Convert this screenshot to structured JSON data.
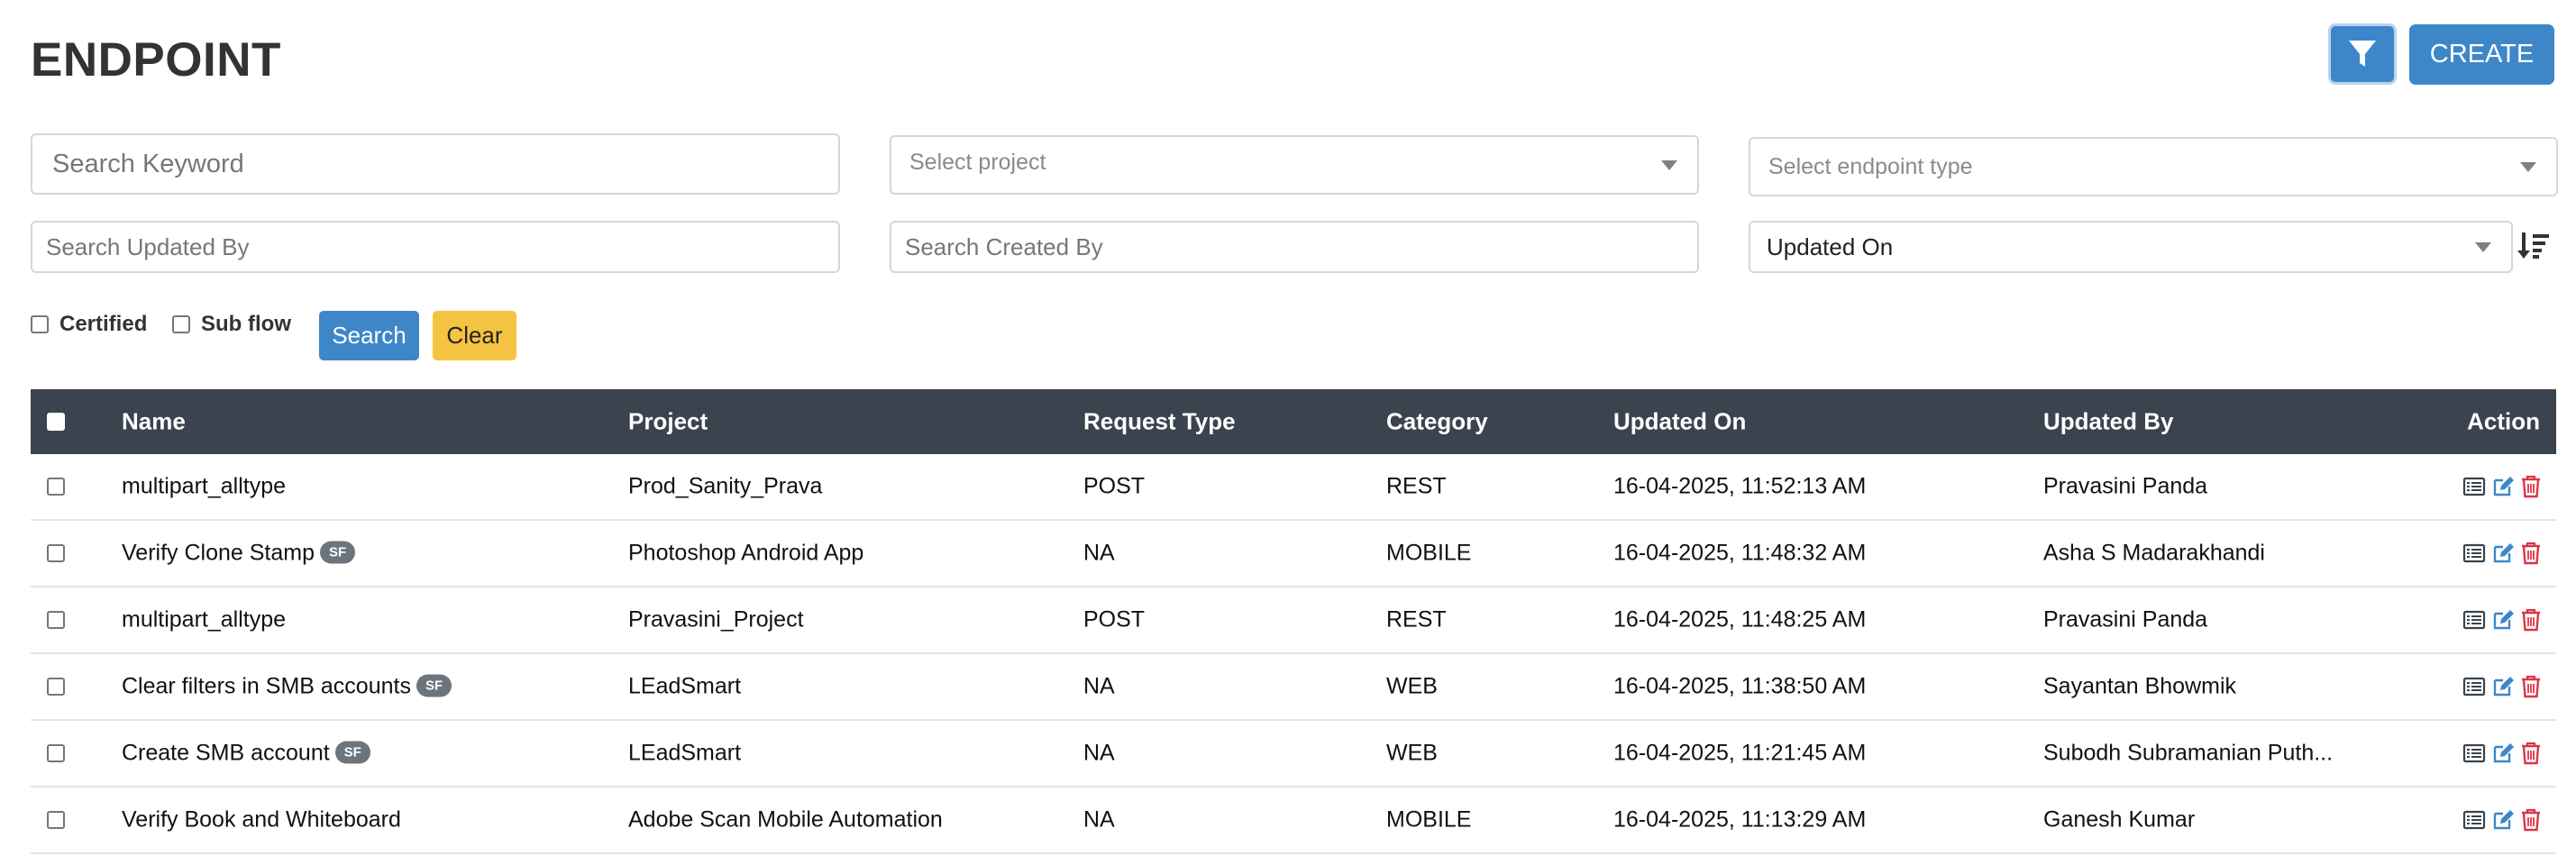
{
  "page": {
    "title": "ENDPOINT"
  },
  "toolbar": {
    "filter_icon": "filter-icon",
    "create_label": "CREATE"
  },
  "filters": {
    "search_keyword_placeholder": "Search Keyword",
    "project_placeholder": "Select project",
    "endpoint_type_placeholder": "Select endpoint type",
    "updated_by_placeholder": "Search Updated By",
    "created_by_placeholder": "Search Created By",
    "sort_by_value": "Updated On",
    "certified_label": "Certified",
    "subflow_label": "Sub flow",
    "search_label": "Search",
    "clear_label": "Clear"
  },
  "table": {
    "columns": [
      "Name",
      "Project",
      "Request Type",
      "Category",
      "Updated On",
      "Updated By",
      "Action"
    ],
    "rows": [
      {
        "name": "multipart_alltype",
        "badge": "",
        "project": "Prod_Sanity_Prava",
        "request_type": "POST",
        "category": "REST",
        "updated_on": "16-04-2025, 11:52:13 AM",
        "updated_by": "Pravasini Panda"
      },
      {
        "name": "Verify Clone Stamp",
        "badge": "SF",
        "project": "Photoshop Android App",
        "request_type": "NA",
        "category": "MOBILE",
        "updated_on": "16-04-2025, 11:48:32 AM",
        "updated_by": "Asha S Madarakhandi"
      },
      {
        "name": "multipart_alltype",
        "badge": "",
        "project": "Pravasini_Project",
        "request_type": "POST",
        "category": "REST",
        "updated_on": "16-04-2025, 11:48:25 AM",
        "updated_by": "Pravasini Panda"
      },
      {
        "name": "Clear filters in SMB accounts",
        "badge": "SF",
        "project": "LEadSmart",
        "request_type": "NA",
        "category": "WEB",
        "updated_on": "16-04-2025, 11:38:50 AM",
        "updated_by": "Sayantan Bhowmik"
      },
      {
        "name": "Create SMB account",
        "badge": "SF",
        "project": "LEadSmart",
        "request_type": "NA",
        "category": "WEB",
        "updated_on": "16-04-2025, 11:21:45 AM",
        "updated_by": "Subodh Subramanian Puth..."
      },
      {
        "name": "Verify Book and Whiteboard",
        "badge": "",
        "project": "Adobe Scan Mobile Automation",
        "request_type": "NA",
        "category": "MOBILE",
        "updated_on": "16-04-2025, 11:13:29 AM",
        "updated_by": "Ganesh Kumar"
      }
    ]
  },
  "colors": {
    "primary": "#3d87c9",
    "warning": "#f5c342",
    "header_bg": "#3a434e",
    "delete": "#dc3545",
    "badge": "#6c757d"
  },
  "icons": {
    "view": "list-icon",
    "edit": "edit-icon",
    "delete": "trash-icon",
    "sort": "sort-descending-icon"
  }
}
